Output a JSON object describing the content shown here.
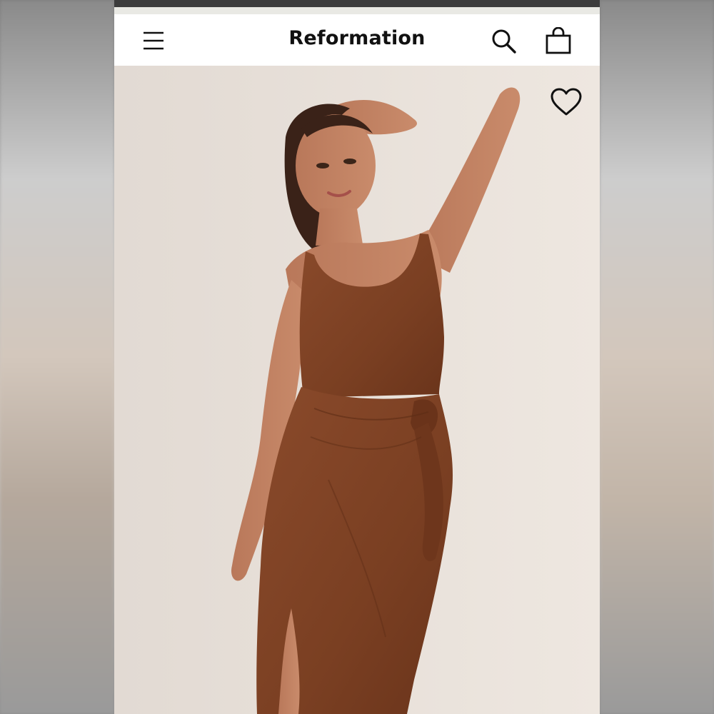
{
  "header": {
    "brand_name": "Reformation",
    "menu_icon": "hamburger-menu-icon",
    "search_icon": "search-icon",
    "bag_icon": "shopping-bag-icon"
  },
  "product": {
    "wishlist_icon": "heart-outline-icon",
    "dress_color": "#7a3f22"
  }
}
